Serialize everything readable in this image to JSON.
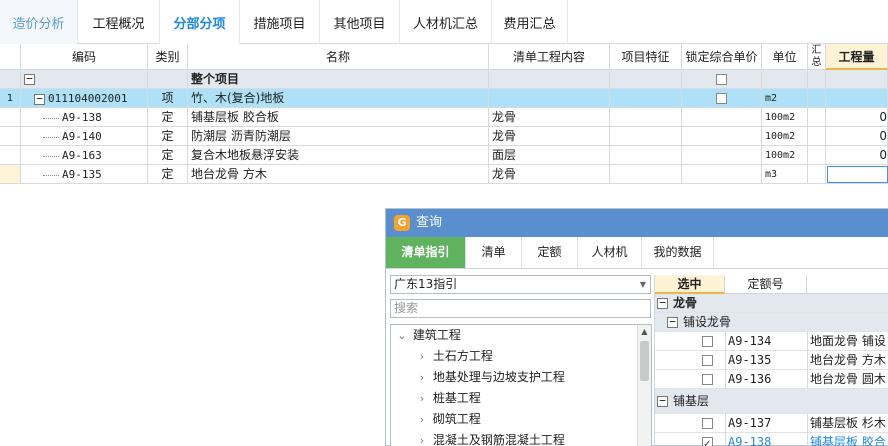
{
  "top_tabs": [
    "造价分析",
    "工程概况",
    "分部分项",
    "措施项目",
    "其他项目",
    "人材机汇总",
    "费用汇总"
  ],
  "grid": {
    "headers": [
      "编码",
      "类别",
      "名称",
      "清单工程内容",
      "项目特征",
      "锁定综合单价",
      "单位",
      "汇总",
      "工程量"
    ],
    "group_row": {
      "name": "整个项目",
      "expander": "−"
    },
    "item_row": {
      "index": "1",
      "code": "011104002001",
      "type": "项",
      "name": "竹、木(复合)地板",
      "unit": "m2",
      "expander": "−"
    },
    "rows": [
      {
        "code": "A9-138",
        "type": "定",
        "name": "铺基层板 胶合板",
        "content": "龙骨",
        "unit": "100m2",
        "qty": "0"
      },
      {
        "code": "A9-140",
        "type": "定",
        "name": "防潮层 沥青防潮层",
        "content": "龙骨",
        "unit": "100m2",
        "qty": "0"
      },
      {
        "code": "A9-163",
        "type": "定",
        "name": "复合木地板悬浮安装",
        "content": "面层",
        "unit": "100m2",
        "qty": "0"
      },
      {
        "code": "A9-135",
        "type": "定",
        "name": "地台龙骨 方木",
        "content": "龙骨",
        "unit": "m3",
        "qty": ""
      }
    ]
  },
  "query_panel": {
    "title": "查询",
    "logo": "G",
    "tabs": [
      "清单指引",
      "清单",
      "定额",
      "人材机",
      "我的数据"
    ],
    "combo_value": "广东13指引",
    "search_placeholder": "搜索",
    "tree": [
      {
        "label": "建筑工程",
        "arrow": "⌄",
        "level": 0
      },
      {
        "label": "土石方工程",
        "arrow": "›",
        "level": 1
      },
      {
        "label": "地基处理与边坡支护工程",
        "arrow": "›",
        "level": 1
      },
      {
        "label": "桩基工程",
        "arrow": "›",
        "level": 1
      },
      {
        "label": "砌筑工程",
        "arrow": "›",
        "level": 1
      },
      {
        "label": "混凝土及钢筋混凝土工程",
        "arrow": "›",
        "level": 1
      }
    ],
    "right_headers": [
      "选中",
      "定额号"
    ],
    "right_rows": [
      {
        "kind": "group",
        "label": "龙骨",
        "expander": "−",
        "level": 0
      },
      {
        "kind": "group",
        "label": "铺设龙骨",
        "expander": "−",
        "level": 1
      },
      {
        "kind": "item",
        "code": "A9-134",
        "name": "地面龙骨 铺设",
        "checked": false
      },
      {
        "kind": "item",
        "code": "A9-135",
        "name": "地台龙骨 方木",
        "checked": false
      },
      {
        "kind": "item",
        "code": "A9-136",
        "name": "地台龙骨 圆木",
        "checked": false
      },
      {
        "kind": "group",
        "label": "铺基层",
        "expander": "−",
        "level": 0
      },
      {
        "kind": "item",
        "code": "A9-137",
        "name": "铺基层板 杉木",
        "checked": false
      },
      {
        "kind": "item",
        "code": "A9-138",
        "name": "铺基层板 胶合",
        "checked": true,
        "highlight": true
      }
    ]
  },
  "colors": {
    "accent": "#1e88e5",
    "item_row": "#aee1f7",
    "group_row": "#e3e8ee",
    "panel_title": "#5a8fcf",
    "active_tab": "#5fb35f"
  }
}
